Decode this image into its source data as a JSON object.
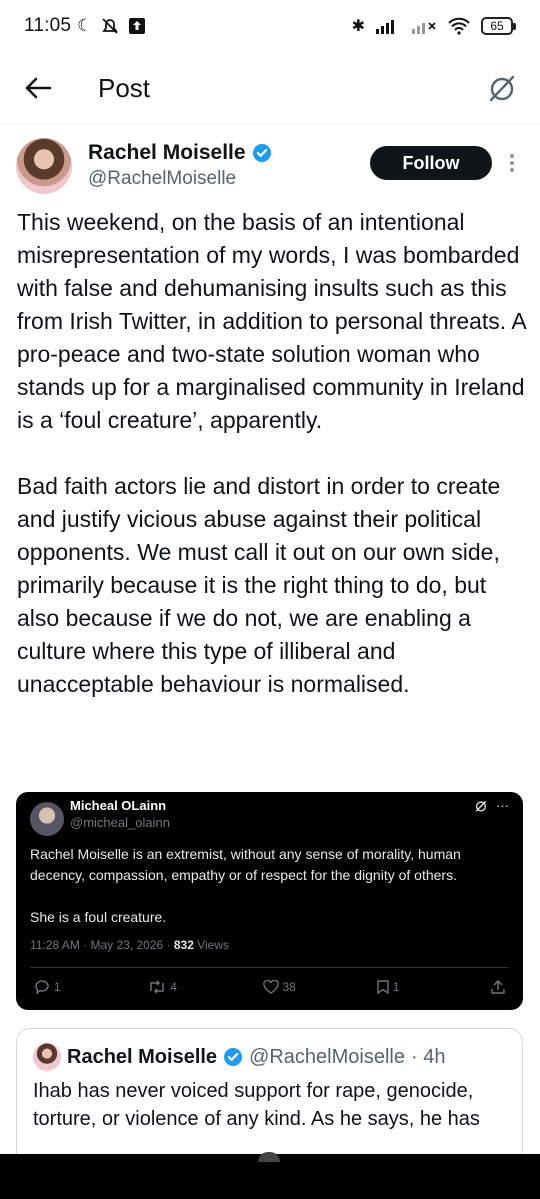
{
  "status_bar": {
    "time": "11:05",
    "battery": "65",
    "icons": [
      "moon-icon",
      "notifications-off-icon",
      "upload-icon",
      "bluetooth-icon",
      "signal-icon",
      "wifi-icon",
      "battery-icon"
    ]
  },
  "header": {
    "title": "Post",
    "back_icon": "arrow-left-icon",
    "grok_icon": "grok-icon"
  },
  "author": {
    "name": "Rachel Moiselle",
    "handle": "@RachelMoiselle",
    "verified": true,
    "follow_label": "Follow"
  },
  "tweet": {
    "text": "This weekend, on the basis of an intentional misrepresentation of my words, I was bombarded with false and dehumanising insults such as this from Irish Twitter, in addition to personal threats. A pro-peace and two-state solution woman who stands up for a marginalised community in Ireland is a ‘foul creature’, apparently.\n\nBad faith actors lie and distort in order to create and justify vicious abuse against their political opponents. We must call it out on our own side, primarily because it is the right thing to do, but also because if we do not, we are enabling a culture where this type of illiberal and unacceptable behaviour is normalised."
  },
  "screenshot_card": {
    "name": "Micheal OLainn",
    "handle": "@micheal_olainn",
    "text": "Rachel Moiselle is an extremist, without any sense of morality, human decency, compassion, empathy or of respect for the dignity of others.\n\nShe is a foul creature.",
    "timestamp": "11:28 AM · May 23, 2026 · ",
    "views_count": "832",
    "views_label": " Views",
    "replies": "1",
    "reposts": "4",
    "likes": "38",
    "bookmarks": "1"
  },
  "quote_card": {
    "name": "Rachel Moiselle",
    "handle": "@RachelMoiselle",
    "time": "· 4h",
    "text": "Ihab has never voiced support for rape, genocide, torture, or violence of any kind. As he says, he has"
  },
  "colors": {
    "text": "#0f1419",
    "secondary": "#536471",
    "verified": "#1d9bf0",
    "card_bg": "#000000"
  }
}
